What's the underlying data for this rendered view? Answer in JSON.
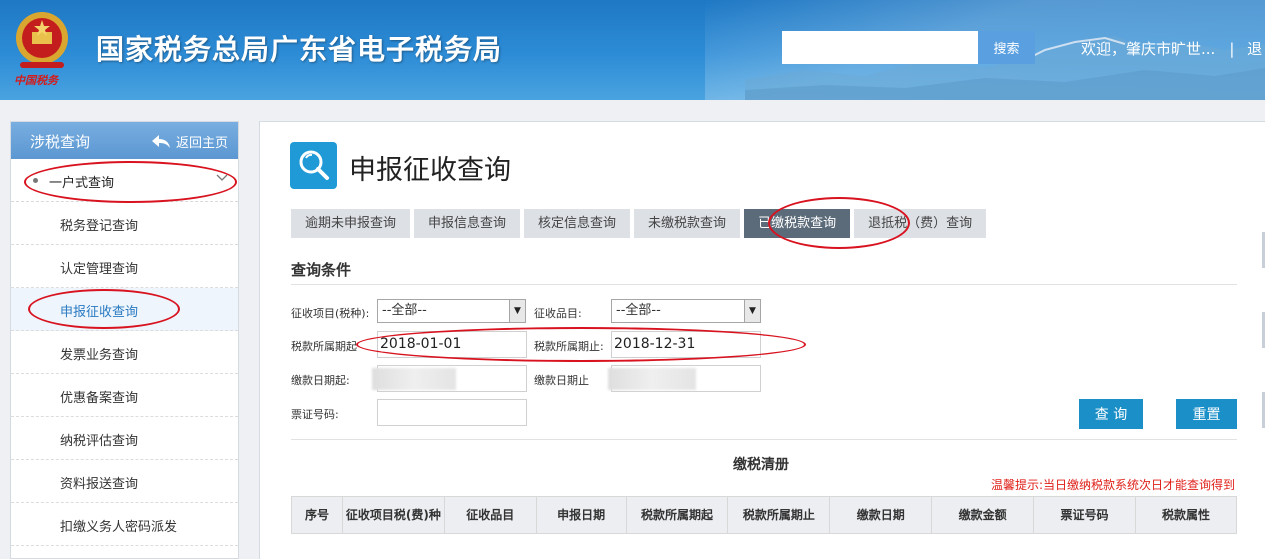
{
  "header": {
    "logo_caption": "中国税务",
    "site_title": "国家税务总局广东省电子税务局",
    "search_placeholder": "",
    "search_label": "搜索",
    "welcome": "欢迎，肇庆市旷世...",
    "separator": "|",
    "exit_partial": "退"
  },
  "sidebar": {
    "title": "涉税查询",
    "back_label": "返回主页",
    "group_label": "一户式查询",
    "items": [
      {
        "label": "税务登记查询"
      },
      {
        "label": "认定管理查询"
      },
      {
        "label": "申报征收查询"
      },
      {
        "label": "发票业务查询"
      },
      {
        "label": "优惠备案查询"
      },
      {
        "label": "纳税评估查询"
      },
      {
        "label": "资料报送查询"
      },
      {
        "label": "扣缴义务人密码派发"
      }
    ],
    "active_index": 2
  },
  "main": {
    "page_title": "申报征收查询",
    "tabs": [
      {
        "label": "逾期未申报查询"
      },
      {
        "label": "申报信息查询"
      },
      {
        "label": "核定信息查询"
      },
      {
        "label": "未缴税款查询"
      },
      {
        "label": "已缴税款查询"
      },
      {
        "label": "退抵税（费）查询"
      }
    ],
    "active_tab": 4,
    "section_title": "查询条件",
    "form": {
      "tax_item_label": "征收项目(税种):",
      "tax_item_value": "--全部--",
      "tax_product_label": "征收品目:",
      "tax_product_value": "--全部--",
      "period_start_label": "税款所属期起",
      "period_start_value": "2018-01-01",
      "period_end_label": "税款所属期止:",
      "period_end_value": "2018-12-31",
      "pay_start_label": "缴款日期起:",
      "pay_end_label": "缴款日期止",
      "ticket_no_label": "票证号码:",
      "ticket_no_value": ""
    },
    "query_label": "查 询",
    "reset_label": "重置",
    "list_title": "缴税清册",
    "tip": "温馨提示:当日缴纳税款系统次日才能查询得到",
    "table_headers": [
      "序号",
      "征收项目税(费)种",
      "征收品目",
      "申报日期",
      "税款所属期起",
      "税款所属期止",
      "缴款日期",
      "缴款金额",
      "票证号码",
      "税款属性"
    ]
  },
  "colors": {
    "header_blue": "#1f78c4",
    "active_tab": "#5c6b7a",
    "primary_button": "#1b8fc7",
    "tip_red": "#e0211a",
    "annotation_red": "#d8131f"
  }
}
